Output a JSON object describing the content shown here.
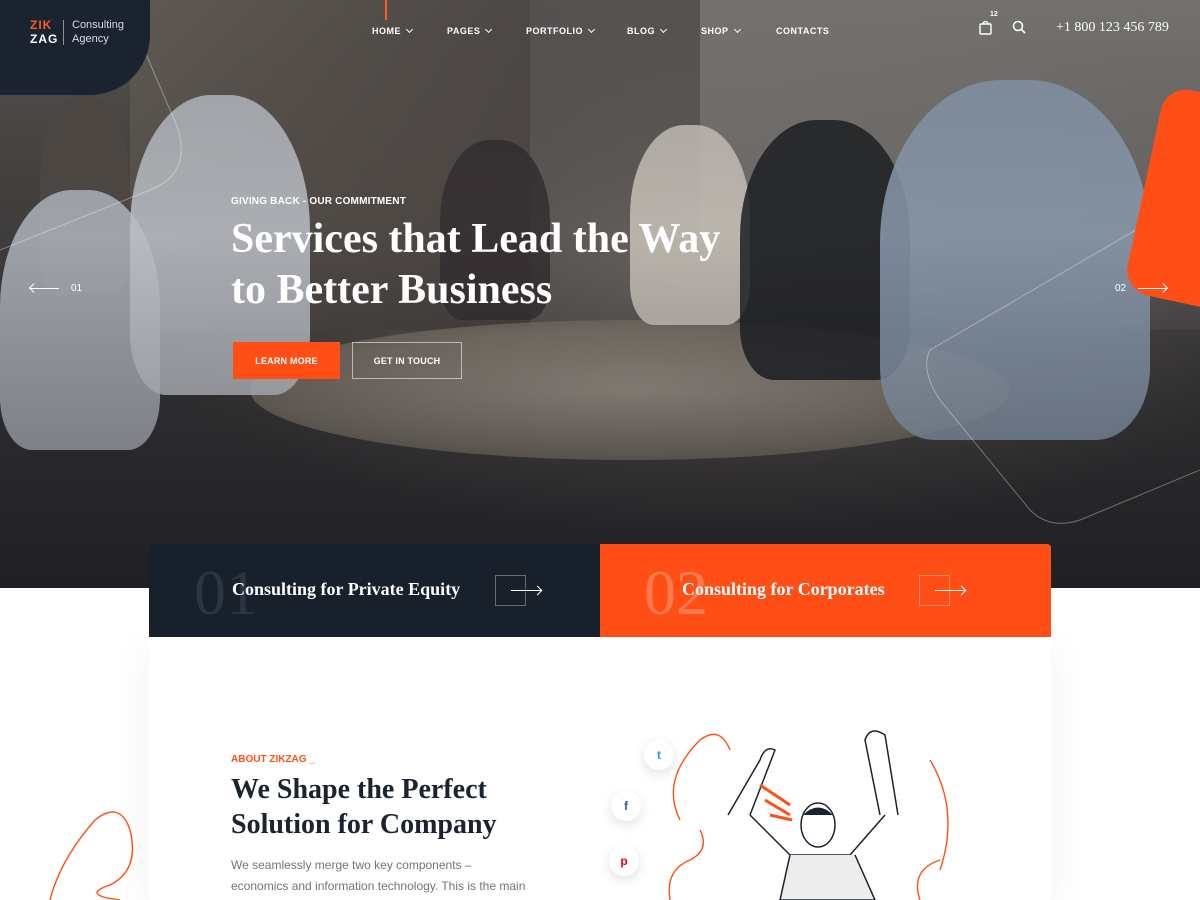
{
  "brand": {
    "mark_line1": "ZIK",
    "mark_line2": "ZAG",
    "tagline_line1": "Consulting",
    "tagline_line2": "Agency",
    "accent": "#ff4f17",
    "dark": "#18202c"
  },
  "nav": {
    "items": [
      {
        "label": "HOME",
        "has_dropdown": true,
        "active": true
      },
      {
        "label": "PAGES",
        "has_dropdown": true
      },
      {
        "label": "PORTFOLIO",
        "has_dropdown": true
      },
      {
        "label": "BLOG",
        "has_dropdown": true
      },
      {
        "label": "SHOP",
        "has_dropdown": true
      },
      {
        "label": "CONTACTS",
        "has_dropdown": false
      }
    ],
    "cart_icon": "shopping-bag-icon",
    "cart_count": "12",
    "search_icon": "search-icon",
    "phone": "+1 800 123 456 789"
  },
  "hero": {
    "eyebrow": "GIVING BACK - OUR COMMITMENT",
    "headline": "Services that Lead the Way to Better Business",
    "primary_button": "LEARN MORE",
    "secondary_button": "GET IN TOUCH",
    "prev_slide": "01",
    "next_slide": "02"
  },
  "services": [
    {
      "number": "01",
      "title": "Consulting for Private Equity"
    },
    {
      "number": "02",
      "title": "Consulting for Corporates"
    }
  ],
  "about": {
    "eyebrow": "ABOUT ZIKZAG _",
    "title": "We Shape the Perfect Solution for Company",
    "body": "We seamlessly merge two key components – economics and information technology. This is the main factor that"
  },
  "social": [
    {
      "icon": "twitter-icon",
      "glyph": "t"
    },
    {
      "icon": "facebook-icon",
      "glyph": "f"
    },
    {
      "icon": "pinterest-icon",
      "glyph": "p"
    }
  ]
}
